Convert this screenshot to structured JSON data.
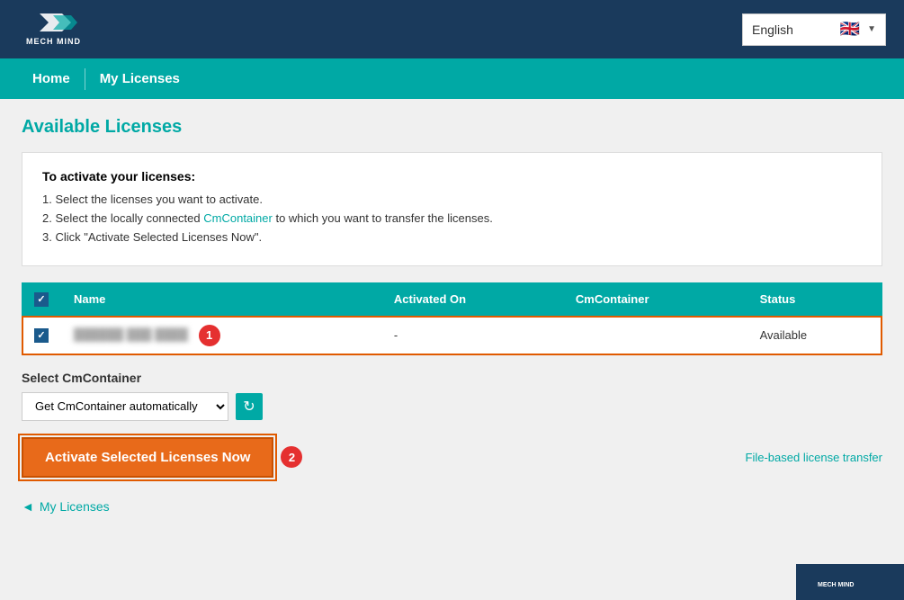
{
  "header": {
    "logo_alt": "Mech Mind",
    "lang_selector": {
      "label": "English",
      "flag": "🇬🇧"
    }
  },
  "nav": {
    "items": [
      {
        "label": "Home",
        "id": "home"
      },
      {
        "label": "My Licenses",
        "id": "my-licenses"
      }
    ]
  },
  "page": {
    "title": "Available Licenses"
  },
  "instructions": {
    "title": "To activate your licenses:",
    "steps": [
      {
        "num": "1.",
        "text": "Select the licenses you want to activate."
      },
      {
        "num": "2.",
        "text_before": "Select the locally connected ",
        "link": "CmContainer",
        "text_after": " to which you want to transfer the licenses."
      },
      {
        "num": "3.",
        "text": "Click \"Activate Selected Licenses Now\"."
      }
    ]
  },
  "table": {
    "headers": [
      "",
      "Name",
      "Activated On",
      "CmContainer",
      "Status"
    ],
    "rows": [
      {
        "checked": true,
        "name": "██████ ███ ████",
        "activated_on": "-",
        "cm_container": "",
        "status": "Available"
      }
    ]
  },
  "cm_container": {
    "label": "Select CmContainer",
    "select_value": "Get CmContainer automatically",
    "options": [
      "Get CmContainer automatically"
    ]
  },
  "activate_button": {
    "label": "Activate Selected Licenses Now"
  },
  "file_transfer": {
    "label": "File-based license transfer"
  },
  "footer_nav": {
    "label": "My Licenses"
  },
  "step_badges": {
    "row_badge": "1",
    "button_badge": "2"
  }
}
